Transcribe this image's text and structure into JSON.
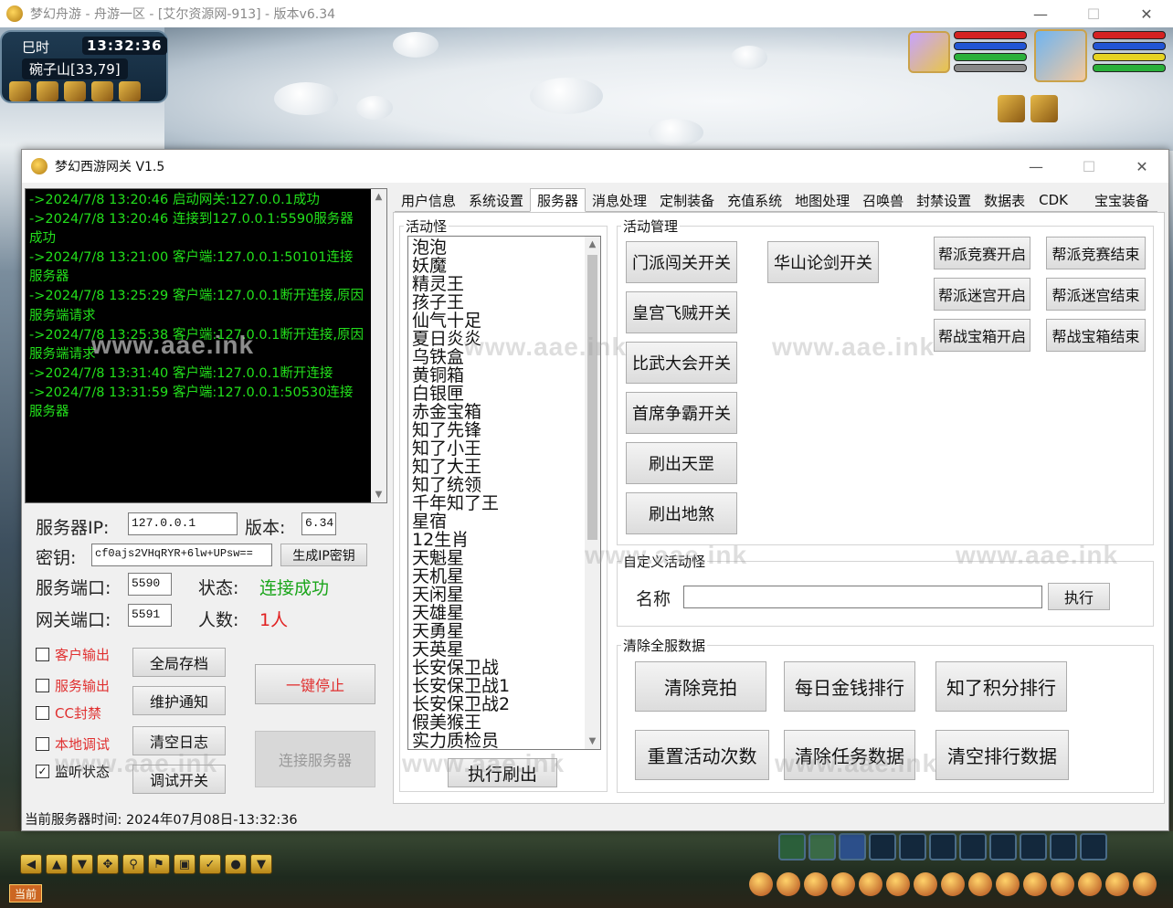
{
  "game": {
    "window_title": "梦幻舟游 - 舟游一区 - [艾尔资源网-913] - 版本v6.34",
    "period": "巳时",
    "time": "13:32:36",
    "location": "碗子山[33,79]",
    "chat_label": "当前",
    "bottom_toolbar_icons": [
      "left-arrow-icon",
      "up-arrow-icon",
      "down-arrow-icon",
      "move-icon",
      "search-icon",
      "flag-icon",
      "lock-icon",
      "check-icon",
      "chat-icon",
      "dropdown-icon"
    ]
  },
  "gateway": {
    "title": "梦幻西游网关 V1.5",
    "log_lines": [
      "->2024/7/8 13:20:46    启动网关:127.0.0.1成功",
      "->2024/7/8 13:20:46    连接到127.0.0.1:5590服务器成功",
      "->2024/7/8 13:21:00    客户端:127.0.0.1:50101连接服务器",
      "->2024/7/8 13:25:29    客户端:127.0.0.1断开连接,原因服务端请求",
      "->2024/7/8 13:25:38    客户端:127.0.0.1断开连接,原因服务端请求",
      "->2024/7/8 13:31:40    客户端:127.0.0.1断开连接",
      "->2024/7/8 13:31:59    客户端:127.0.0.1:50530连接服务器"
    ],
    "form": {
      "server_ip_label": "服务器IP:",
      "server_ip_value": "127.0.0.1",
      "version_label": "版本:",
      "version_value": "6.34",
      "key_label": "密钥:",
      "key_value": "cf0ajs2VHqRYR+6lw+UPsw==",
      "gen_key_button": "生成IP密钥",
      "server_port_label": "服务端口:",
      "server_port_value": "5590",
      "status_label": "状态:",
      "status_value": "连接成功",
      "gateway_port_label": "网关端口:",
      "gateway_port_value": "5591",
      "count_label": "人数:",
      "count_value": "1人"
    },
    "checkboxes": [
      {
        "label": "客户输出",
        "checked": false,
        "red": true
      },
      {
        "label": "服务输出",
        "checked": false,
        "red": true
      },
      {
        "label": "CC封禁",
        "checked": false,
        "red": true
      },
      {
        "label": "本地调试",
        "checked": false,
        "red": true
      },
      {
        "label": "监听状态",
        "checked": true,
        "red": false
      }
    ],
    "buttons": {
      "save_all": "全局存档",
      "maintenance": "维护通知",
      "clear_log": "清空日志",
      "debug_toggle": "调试开关",
      "stop_all": "一键停止",
      "connect_server": "连接服务器"
    },
    "status_bar": "当前服务器时间:  2024年07月08日-13:32:36",
    "tabs": [
      "用户信息",
      "系统设置",
      "服务器",
      "消息处理",
      "定制装备",
      "充值系统",
      "地图处理",
      "召唤兽",
      "封禁设置",
      "数据表",
      "CDK",
      "宝宝装备"
    ],
    "active_tab": "服务器",
    "monster_group_label": "活动怪",
    "monsters": [
      "泡泡",
      "妖魔",
      "精灵王",
      "孩子王",
      "仙气十足",
      "夏日炎炎",
      "乌铁盒",
      "黄铜箱",
      "白银匣",
      "赤金宝箱",
      "知了先锋",
      "知了小王",
      "知了大王",
      "知了统领",
      "千年知了王",
      "星宿",
      "12生肖",
      "天魁星",
      "天机星",
      "天闲星",
      "天雄星",
      "天勇星",
      "天英星",
      "长安保卫战",
      "长安保卫战1",
      "长安保卫战2",
      "假美猴王",
      "实力质检员"
    ],
    "execute_refresh": "执行刷出",
    "activity_group_label": "活动管理",
    "activity_buttons": [
      "门派闯关开关",
      "皇宫飞贼开关",
      "比武大会开关",
      "首席争霸开关",
      "刷出天罡",
      "刷出地煞"
    ],
    "huashan": "华山论剑开关",
    "guild_buttons": [
      "帮派竞赛开启",
      "帮派竞赛结束",
      "帮派迷宫开启",
      "帮派迷宫结束",
      "帮战宝箱开启",
      "帮战宝箱结束"
    ],
    "custom_group_label": "自定义活动怪",
    "name_label": "名称",
    "custom_name_value": "",
    "execute": "执行",
    "clear_group_label": "清除全服数据",
    "clear_buttons": [
      "清除竞拍",
      "每日金钱排行",
      "知了积分排行",
      "重置活动次数",
      "清除任务数据",
      "清空排行数据"
    ]
  },
  "watermark": "www.aae.ink",
  "colors": {
    "log_text": "#23e01c",
    "status_ok": "#1aa51a",
    "accent_red": "#e12020"
  }
}
